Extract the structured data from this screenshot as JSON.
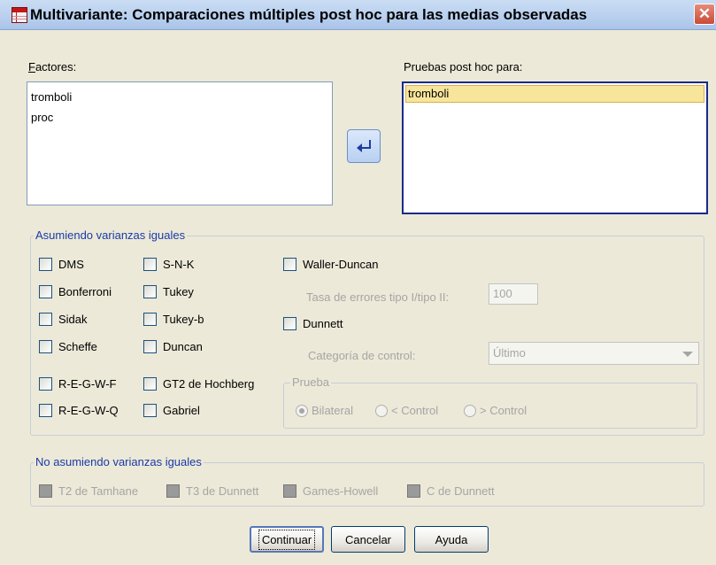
{
  "window": {
    "title": "Multivariante: Comparaciones múltiples post hoc para las medias observadas"
  },
  "factores": {
    "label": "Factores:",
    "items": [
      "tromboli",
      "proc"
    ]
  },
  "pruebas": {
    "label": "Pruebas post hoc para:",
    "items": [
      "tromboli"
    ]
  },
  "asumiendo": {
    "legend": "Asumiendo varianzas iguales",
    "col1": [
      "DMS",
      "Bonferroni",
      "Sidak",
      "Scheffe",
      "R-E-G-W-F",
      "R-E-G-W-Q"
    ],
    "col2": [
      "S-N-K",
      "Tukey",
      "Tukey-b",
      "Duncan",
      "GT2 de Hochberg",
      "Gabriel"
    ],
    "waller": "Waller-Duncan",
    "tasa_label": "Tasa de errores tipo I/tipo II:",
    "tasa_value": "100",
    "dunnett": "Dunnett",
    "categoria_label": "Categoría de control:",
    "categoria_value": "Último",
    "prueba": {
      "legend": "Prueba",
      "options": [
        "Bilateral",
        "< Control",
        "> Control"
      ],
      "selected": "Bilateral"
    }
  },
  "no_asumiendo": {
    "legend": "No asumiendo varianzas iguales",
    "items": [
      "T2 de Tamhane",
      "T3 de Dunnett",
      "Games-Howell",
      "C de Dunnett"
    ]
  },
  "buttons": {
    "continuar": "Continuar",
    "cancelar": "Cancelar",
    "ayuda": "Ayuda"
  },
  "icons": {
    "title": "spss-grid-icon",
    "close": "close-icon",
    "move": "arrow-move-icon"
  },
  "colors": {
    "selected_item": "#f8e59c",
    "legend_blue": "#1a3aa8"
  }
}
